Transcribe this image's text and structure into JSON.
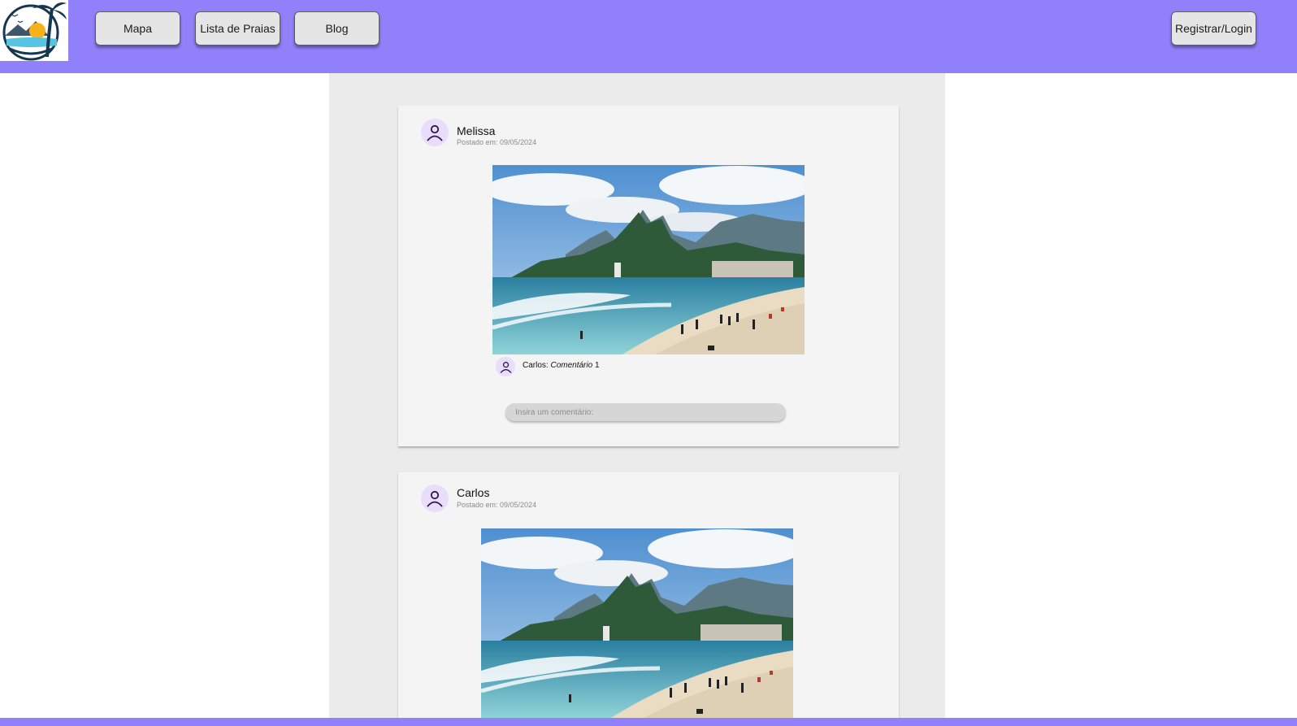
{
  "nav": {
    "mapa": "Mapa",
    "lista": "Lista de Praias",
    "blog": "Blog",
    "login": "Registrar/Login"
  },
  "posts": [
    {
      "author": "Melissa",
      "date": "Postado em: 09/05/2024",
      "comments": [
        {
          "user": "Carlos:",
          "text": "Comentário",
          "number": "1"
        }
      ],
      "input_placeholder": "Insira um comentário:"
    },
    {
      "author": "Carlos",
      "date": "Postado em: 09/05/2024"
    }
  ],
  "colors": {
    "accent": "#9081fb",
    "feed_bg": "#ebebeb",
    "card_bg": "#f4f4f4",
    "avatar_bg": "#eadcfb"
  },
  "icons": {
    "user": "person-outline-icon",
    "logo": "palm-beach-logo"
  }
}
